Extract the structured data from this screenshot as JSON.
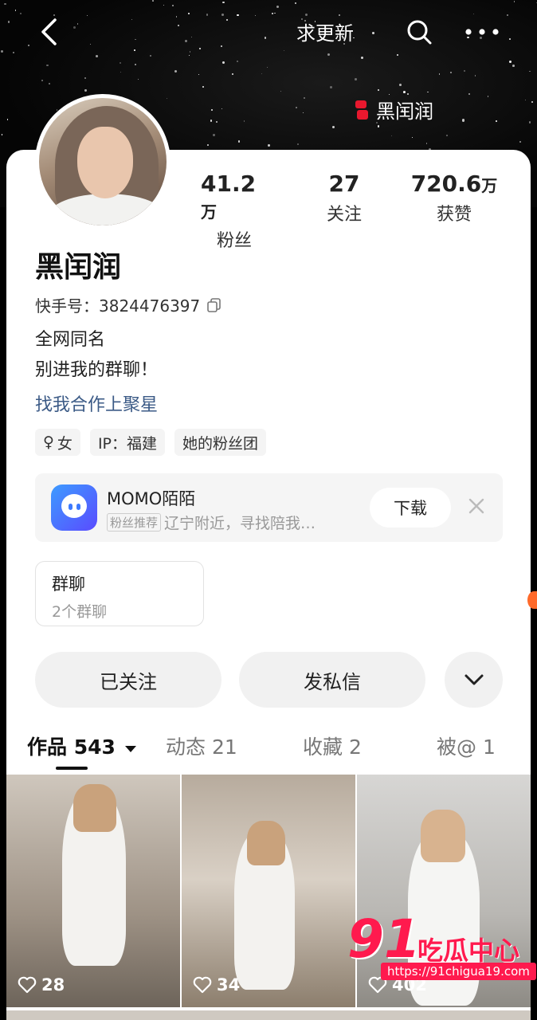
{
  "header": {
    "back_icon": "chevron-left-icon",
    "request_update": "求更新",
    "search_icon": "search-icon",
    "more_icon": "more-horizontal-icon",
    "brand_name": "黑闰润"
  },
  "profile": {
    "stats": [
      {
        "num": "41.2",
        "unit": "万",
        "label": "粉丝"
      },
      {
        "num": "27",
        "unit": "",
        "label": "关注"
      },
      {
        "num": "720.6",
        "unit": "万",
        "label": "获赞"
      }
    ],
    "name": "黑闰润",
    "kuaishou_id_label": "快手号：",
    "kuaishou_id": "3824476397",
    "bio_line1": "全网同名",
    "bio_line2": "别进我的群聊！",
    "collab_link": "找我合作上聚星",
    "tags": {
      "gender_symbol": "♀",
      "gender": "女",
      "ip": "IP：福建",
      "fan_group": "她的粉丝团"
    }
  },
  "ad": {
    "app_name": "MOMO陌陌",
    "badge": "粉丝推荐",
    "subtitle": "辽宁附近，寻找陪我…",
    "download": "下载",
    "close_icon": "close-icon"
  },
  "group_chat": {
    "title": "群聊",
    "subtitle": "2个群聊"
  },
  "actions": {
    "followed": "已关注",
    "message": "发私信",
    "more_icon": "chevron-down-icon"
  },
  "tabs": [
    {
      "label": "作品 543",
      "active": true
    },
    {
      "label": "动态 21",
      "active": false
    },
    {
      "label": "收藏 2",
      "active": false
    },
    {
      "label": "被@ 1",
      "active": false
    }
  ],
  "grid": [
    {
      "likes": "28"
    },
    {
      "likes": "34"
    },
    {
      "likes": "402"
    }
  ],
  "watermark": {
    "num": "91",
    "text": "吃瓜中心",
    "url": "https://91chigua19.com"
  },
  "colors": {
    "link": "#3b5a86",
    "watermark": "#ff1a4e",
    "ad_icon": "#3d9bff"
  }
}
